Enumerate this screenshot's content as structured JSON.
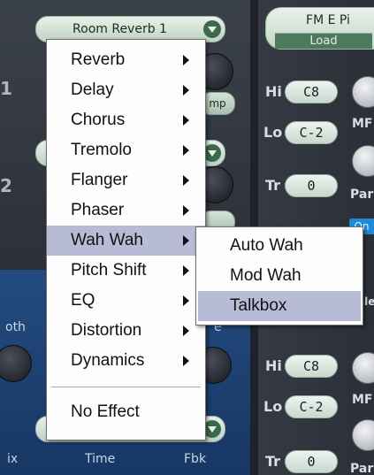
{
  "top_preset": {
    "label": "Room Reverb 1",
    "icon": "chevron-down-icon"
  },
  "left_panel": {
    "row_numbers": [
      "1",
      "2"
    ],
    "stub_text": "mp",
    "knob_label_left": "oth",
    "knob_label_right": "e",
    "bottom_labels": [
      "ix",
      "Time",
      "Fbk"
    ]
  },
  "right_panel": {
    "fm_title": "FM E Pi",
    "load_label": "Load",
    "params_upper": [
      {
        "label": "Hi",
        "value": "C8"
      },
      {
        "label": "Lo",
        "value": "C-2"
      },
      {
        "label": "Tr",
        "value": "0"
      }
    ],
    "params_lower": [
      {
        "label": "Hi",
        "value": "C8"
      },
      {
        "label": "Lo",
        "value": "C-2"
      },
      {
        "label": "Tr",
        "value": "0"
      }
    ],
    "mf_label": "MF",
    "par_label": "Par",
    "on_label": "On",
    "ale_label": "ale"
  },
  "menu": {
    "items": [
      {
        "label": "Reverb",
        "submenu": true
      },
      {
        "label": "Delay",
        "submenu": true
      },
      {
        "label": "Chorus",
        "submenu": true
      },
      {
        "label": "Tremolo",
        "submenu": true
      },
      {
        "label": "Flanger",
        "submenu": true
      },
      {
        "label": "Phaser",
        "submenu": true
      },
      {
        "label": "Wah Wah",
        "submenu": true,
        "active": true
      },
      {
        "label": "Pitch Shift",
        "submenu": true
      },
      {
        "label": "EQ",
        "submenu": true
      },
      {
        "label": "Distortion",
        "submenu": true
      },
      {
        "label": "Dynamics",
        "submenu": true
      }
    ],
    "no_effect": "No Effect"
  },
  "submenu": {
    "items": [
      {
        "label": "Auto Wah"
      },
      {
        "label": "Mod Wah"
      },
      {
        "label": "Talkbox",
        "active": true
      }
    ]
  },
  "colors": {
    "menu_highlight": "#b8bbd6",
    "panel_blue": "#244b7f",
    "pill_green": "#3c6a4c",
    "on_blue": "#1f8bd6"
  }
}
